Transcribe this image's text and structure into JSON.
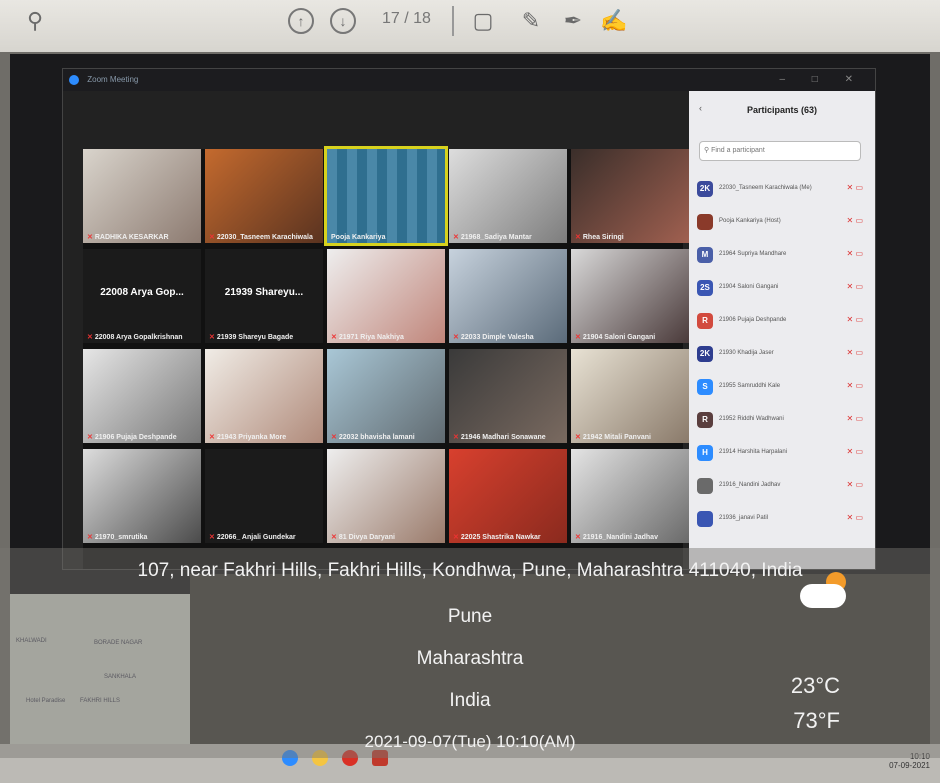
{
  "toolbar": {
    "page_current": "17",
    "page_sep": "/",
    "page_total": "18"
  },
  "zoom": {
    "window_title": "Zoom Meeting"
  },
  "gallery": {
    "tiles": [
      {
        "name": "RADHIKA KESARKAR"
      },
      {
        "name": "22030_Tasneem Karachiwala"
      },
      {
        "name": "Pooja Kankariya"
      },
      {
        "name": "21968_Sadiya Mantar"
      },
      {
        "name": "Rhea Siringi"
      },
      {
        "big": "22008 Arya Gop...",
        "name": "22008 Arya Gopalkrishnan"
      },
      {
        "big": "21939 Shareyu...",
        "name": "21939 Shareyu Bagade"
      },
      {
        "name": "21971 Riya Nakhiya"
      },
      {
        "name": "22033 Dimple Valesha"
      },
      {
        "name": "21904 Saloni Gangani"
      },
      {
        "name": "21906 Pujaja Deshpande"
      },
      {
        "name": "21943 Priyanka More"
      },
      {
        "name": "22032 bhavisha lamani"
      },
      {
        "name": "21946 Madhari Sonawane"
      },
      {
        "name": "21942 Mitali Panvani"
      },
      {
        "name": "21970_smrutika"
      },
      {
        "name": "22066_ Anjali Gundekar"
      },
      {
        "name": "81 Divya Daryani"
      },
      {
        "name": "22025 Shastrika Nawkar"
      },
      {
        "name": "21916_Nandini Jadhav"
      }
    ]
  },
  "participants": {
    "back": "‹",
    "title": "Participants (63)",
    "search_placeholder": "Find a participant",
    "items": [
      {
        "initials": "2K",
        "name": "22030_Tasneem Karachiwala (Me)",
        "color": "#3b4a9c"
      },
      {
        "initials": "",
        "name": "Pooja Kankariya (Host)",
        "color": "#8a3a2a"
      },
      {
        "initials": "M",
        "name": "21964 Supriya Mandhare",
        "color": "#4a5fa8"
      },
      {
        "initials": "2S",
        "name": "21904 Saloni Gangani",
        "color": "#3a56b3"
      },
      {
        "initials": "R",
        "name": "21906 Pujaja Deshpande",
        "color": "#d24a3e"
      },
      {
        "initials": "2K",
        "name": "21930 Khadija Jaser",
        "color": "#2e3d8f"
      },
      {
        "initials": "S",
        "name": "21955 Samruddhi Kale",
        "color": "#2d8cff"
      },
      {
        "initials": "R",
        "name": "21952 Riddhi Wadhwani",
        "color": "#5a3e3e"
      },
      {
        "initials": "H",
        "name": "21914 Harshita Harpalani",
        "color": "#2d8cff"
      },
      {
        "initials": "",
        "name": "21916_Nandini Jadhav",
        "color": "#6a6a6a"
      },
      {
        "initials": "",
        "name": "21936_janavi Patil",
        "color": "#3a56b3"
      }
    ]
  },
  "map": {
    "labels": [
      "BORADE NAGAR",
      "KHALWADI",
      "SANKHALA",
      "Hotel Paradise",
      "FAKHRI HILLS"
    ]
  },
  "geotag": {
    "address": "107, near Fakhri Hills, Fakhri Hills, Kondhwa, Pune, Maharashtra 411040, India",
    "city": "Pune",
    "state": "Maharashtra",
    "country": "India",
    "datetime": "2021-09-07(Tue)   10:10(AM)",
    "temp_c": "23°C",
    "temp_f": "73°F"
  },
  "taskbar": {
    "time": "10:10",
    "date": "07-09-2021"
  },
  "colors": {
    "zoom_blue": "#2d8cff",
    "active_speaker": "#d7d21e",
    "muted_red": "#e33333"
  }
}
